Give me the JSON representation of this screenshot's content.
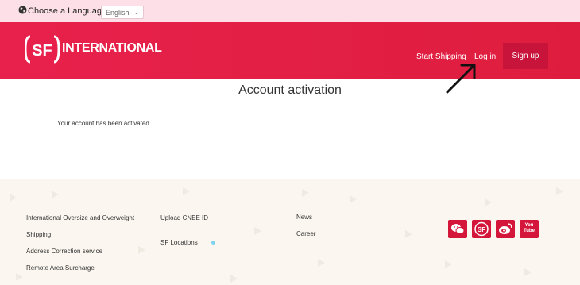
{
  "language_bar": {
    "label": "Choose a Language:",
    "selected_language": "English"
  },
  "header": {
    "logo_text": "INTERNATIONAL",
    "logo_badge": "SF",
    "nav": {
      "start_shipping": "Start Shipping",
      "log_in": "Log in",
      "sign_up": "Sign up"
    }
  },
  "main": {
    "title": "Account activation",
    "message": "Your account has been activated"
  },
  "footer": {
    "column1": [
      "International Oversize and Overweight",
      "Shipping",
      "Address Correction service",
      "Remote Area Surcharge"
    ],
    "column2": [
      "Upload CNEE ID",
      "SF Locations"
    ],
    "column3": [
      "News",
      "Career"
    ],
    "social_icons": [
      "wechat-icon",
      "sf-icon",
      "weibo-icon",
      "youtube-icon"
    ],
    "youtube_text": "You Tube"
  },
  "colors": {
    "brand_red": "#e8214c",
    "signup_bg": "#c8143a",
    "lang_bar_bg": "#fde0e7",
    "footer_bg": "#fbf7f0"
  }
}
